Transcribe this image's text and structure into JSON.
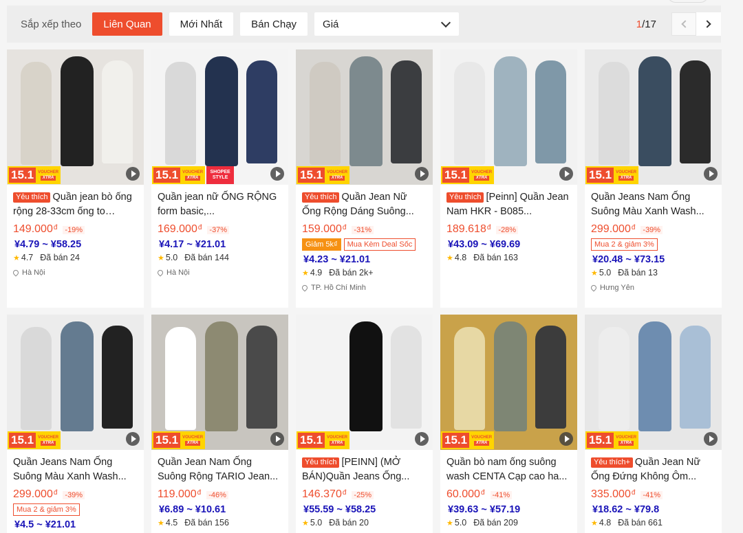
{
  "sort": {
    "label": "Sắp xếp theo",
    "options": [
      "Liên Quan",
      "Mới Nhất",
      "Bán Chạy"
    ],
    "active": "Liên Quan",
    "price_select": "Giá",
    "page_current": "1",
    "page_total": "/17"
  },
  "badge": {
    "promo": "15.1",
    "voucher": "VOUCHER",
    "xtra": "XTRA",
    "shopee_style_1": "SHOPEE",
    "shopee_style_2": "STYLE"
  },
  "products": [
    {
      "fav": "Yêu thích",
      "title": "Quần jean bò ống rộng 28-33cm ống to suông...",
      "price": "149.000",
      "discount": "-19%",
      "tags": [],
      "yen": "¥4.79 ~ ¥58.25",
      "rating": "4.7",
      "sold": "Đã bán 24",
      "location": "Hà Nội",
      "shopee_style": false
    },
    {
      "fav": "",
      "title": "Quần jean nữ ỐNG RỘNG form basic,...",
      "price": "169.000",
      "discount": "-37%",
      "tags": [],
      "yen": "¥4.17 ~ ¥21.01",
      "rating": "5.0",
      "sold": "Đã bán 144",
      "location": "Hà Nội",
      "shopee_style": true
    },
    {
      "fav": "Yêu thích",
      "title": "Quần Jean Nữ Ống Rộng Dáng Suông...",
      "price": "159.000",
      "discount": "-31%",
      "tags": [
        "Giảm 5k₫",
        "Mua Kèm Deal Sốc"
      ],
      "yen": "¥4.23 ~ ¥21.01",
      "rating": "4.9",
      "sold": "Đã bán 2k+",
      "location": "TP. Hồ Chí Minh",
      "shopee_style": false
    },
    {
      "fav": "Yêu thích",
      "title": "[Peinn] Quần Jean Nam HKR - B085...",
      "price": "189.618",
      "discount": "-28%",
      "tags": [],
      "yen": "¥43.09 ~ ¥69.69",
      "rating": "4.8",
      "sold": "Đã bán 163",
      "location": "",
      "shopee_style": false
    },
    {
      "fav": "",
      "title": "Quần Jeans Nam Ống Suông Màu Xanh Wash...",
      "price": "299.000",
      "discount": "-39%",
      "tags": [
        "Mua 2 & giảm 3%"
      ],
      "yen": "¥20.48 ~ ¥73.15",
      "rating": "5.0",
      "sold": "Đã bán 13",
      "location": "Hưng Yên",
      "shopee_style": false
    },
    {
      "fav": "",
      "title": "Quần Jeans Nam Ống Suông Màu Xanh Wash...",
      "price": "299.000",
      "discount": "-39%",
      "tags": [
        "Mua 2 & giảm 3%"
      ],
      "yen": "¥4.5 ~ ¥21.01",
      "rating": "",
      "sold": "",
      "location": "",
      "shopee_style": false
    },
    {
      "fav": "",
      "title": "Quần Jean Nam Ống Suông Rộng TARIO Jean...",
      "price": "119.000",
      "discount": "-46%",
      "tags": [],
      "yen": "¥6.89 ~ ¥10.61",
      "rating": "4.5",
      "sold": "Đã bán 156",
      "location": "",
      "shopee_style": false
    },
    {
      "fav": "Yêu thích",
      "title": "[PEINN] (MỞ BÁN)Quần Jeans Ống...",
      "price": "146.370",
      "discount": "-25%",
      "tags": [],
      "yen": "¥55.59 ~ ¥58.25",
      "rating": "5.0",
      "sold": "Đã bán 20",
      "location": "",
      "shopee_style": false
    },
    {
      "fav": "",
      "title": "Quần bò nam ống suông wash CENTA Cạp cao ha...",
      "price": "60.000",
      "discount": "-41%",
      "tags": [],
      "yen": "¥39.63 ~ ¥57.19",
      "rating": "5.0",
      "sold": "Đã bán 209",
      "location": "",
      "shopee_style": false
    },
    {
      "fav": "Yêu thích+",
      "title": "Quần Jean Nữ Ống Đứng Không Ôm...",
      "price": "335.000",
      "discount": "-41%",
      "tags": [],
      "yen": "¥18.62 ~ ¥79.8",
      "rating": "4.8",
      "sold": "Đã bán 661",
      "location": "",
      "shopee_style": false
    }
  ],
  "colors": {
    "accent": "#ee4d2d",
    "yen": "#1a14b8",
    "star": "#ffb800"
  }
}
